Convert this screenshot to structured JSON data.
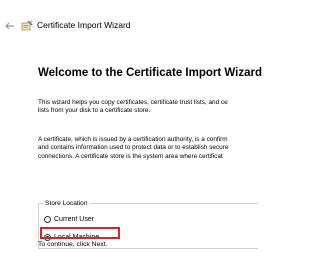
{
  "window": {
    "title": "Certificate Import Wizard",
    "back_icon": "back-arrow-icon",
    "app_icon": "certificate-wizard-icon"
  },
  "main": {
    "heading": "Welcome to the Certificate Import Wizard",
    "para1_line1": "This wizard helps you copy certificates, certificate trust lists, and ce",
    "para1_line2": "lists from your disk to a certificate store.",
    "para2_line1": "A certificate, which is issued by a certification authority, is a confirm",
    "para2_line2": "and contains information used to protect data or to establish secure",
    "para2_line3": "connections. A certificate store is the system area where certificat"
  },
  "store_location": {
    "legend": "Store Location",
    "options": [
      {
        "label": "Current User",
        "selected": false
      },
      {
        "label": "Local Machine",
        "selected": true
      }
    ],
    "highlight_color": "#e0202a"
  },
  "footer": {
    "text": "To continue, click Next."
  }
}
